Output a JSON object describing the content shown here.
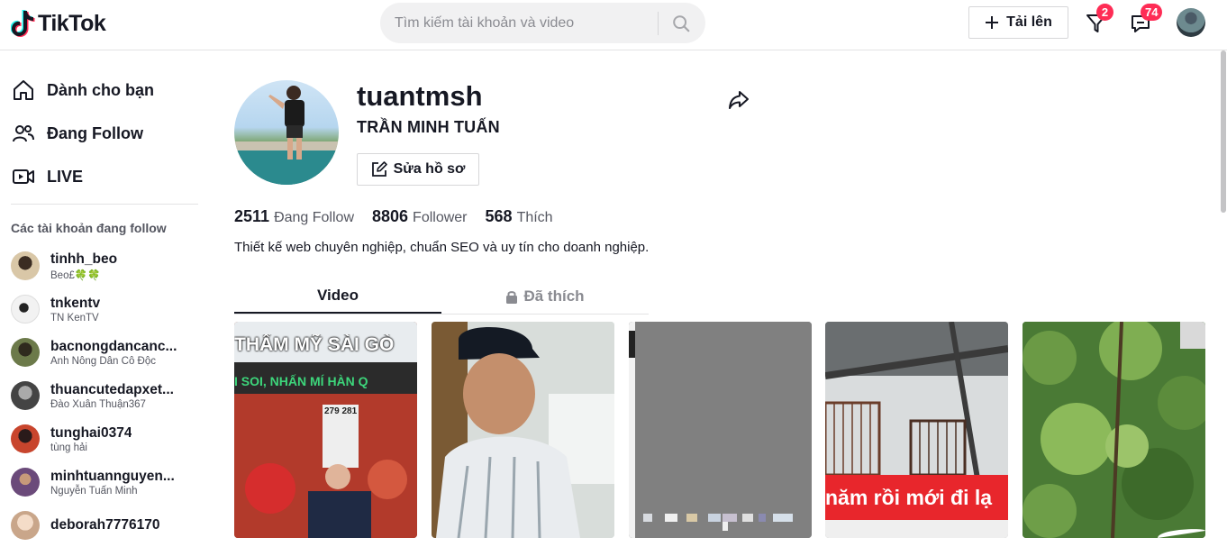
{
  "header": {
    "logo_text": "TikTok",
    "search_placeholder": "Tìm kiếm tài khoản và video",
    "upload_label": "Tải lên",
    "inbox_badge": "2",
    "messages_badge": "74"
  },
  "sidebar": {
    "nav": [
      {
        "label": "Dành cho bạn",
        "icon": "home-icon"
      },
      {
        "label": "Đang Follow",
        "icon": "people-icon"
      },
      {
        "label": "LIVE",
        "icon": "live-icon"
      }
    ],
    "following_title": "Các tài khoản đang follow",
    "accounts": [
      {
        "user": "tinhh_beo",
        "name": "Beo£🍀🍀",
        "color": "#d9c7a7"
      },
      {
        "user": "tnkentv",
        "name": "TN KenTV",
        "color": "#e8e8e8"
      },
      {
        "user": "bacnongdancanc...",
        "name": "Anh Nông Dân Cô Độc",
        "color": "#6c7a4a"
      },
      {
        "user": "thuancutedapxet...",
        "name": "Đào Xuân Thuận367",
        "color": "#555"
      },
      {
        "user": "tunghai0374",
        "name": "tùng hải",
        "color": "#c8452d"
      },
      {
        "user": "minhtuannguyen...",
        "name": "Nguyễn Tuấn Minh",
        "color": "#6b4a7a"
      },
      {
        "user": "deborah7776170",
        "name": "",
        "color": "#e6c8b0"
      }
    ]
  },
  "profile": {
    "username": "tuantmsh",
    "fullname": "TRẦN MINH TUẤN",
    "edit_label": "Sửa hồ sơ",
    "following_count": "2511",
    "following_label": "Đang Follow",
    "follower_count": "8806",
    "follower_label": "Follower",
    "likes_count": "568",
    "likes_label": "Thích",
    "bio": "Thiết kế web chuyên nghiệp, chuẩn SEO và uy tín cho doanh nghiệp."
  },
  "tabs": {
    "videos": "Video",
    "liked": "Đã thích"
  },
  "videos": [
    {
      "caption_top": "THẨM MỸ SÀI GÒ",
      "caption_mid": "I SOI, NHẤN MÍ HÀN Q",
      "sign": "279 281"
    },
    {},
    {},
    {
      "caption": "năm rồi mới đi lạ"
    },
    {}
  ],
  "colors": {
    "accent": "#fe2c55",
    "text": "#161823",
    "muted": "#545660"
  }
}
